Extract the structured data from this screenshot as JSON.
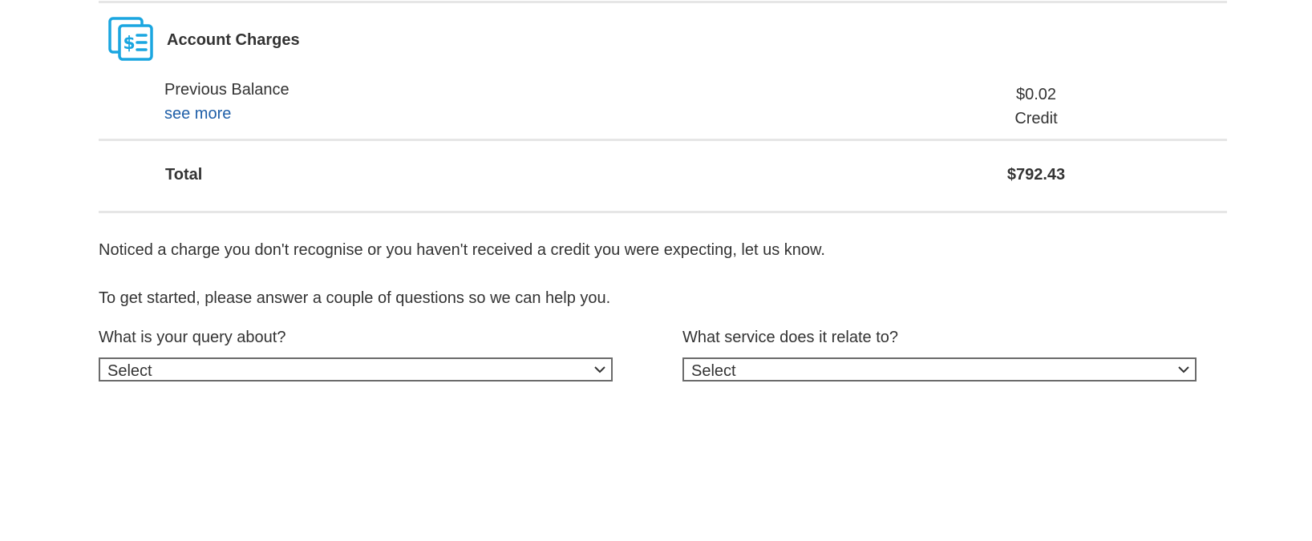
{
  "charges": {
    "title": "Account Charges",
    "icon": "billing-document-icon",
    "accent_color": "#1aa6e0",
    "items": [
      {
        "label": "Previous Balance",
        "link_text": "see more",
        "amount": "$0.02",
        "note": "Credit"
      }
    ],
    "total_label": "Total",
    "total_amount": "$792.43"
  },
  "help": {
    "intro": "Noticed a charge you don't recognise or you haven't received a credit you were expecting, let us know.",
    "prompt": "To get started, please answer a couple of questions so we can help you."
  },
  "form": {
    "query": {
      "label": "What is your query about?",
      "value": "Select"
    },
    "service": {
      "label": "What service does it relate to?",
      "value": "Select"
    }
  }
}
